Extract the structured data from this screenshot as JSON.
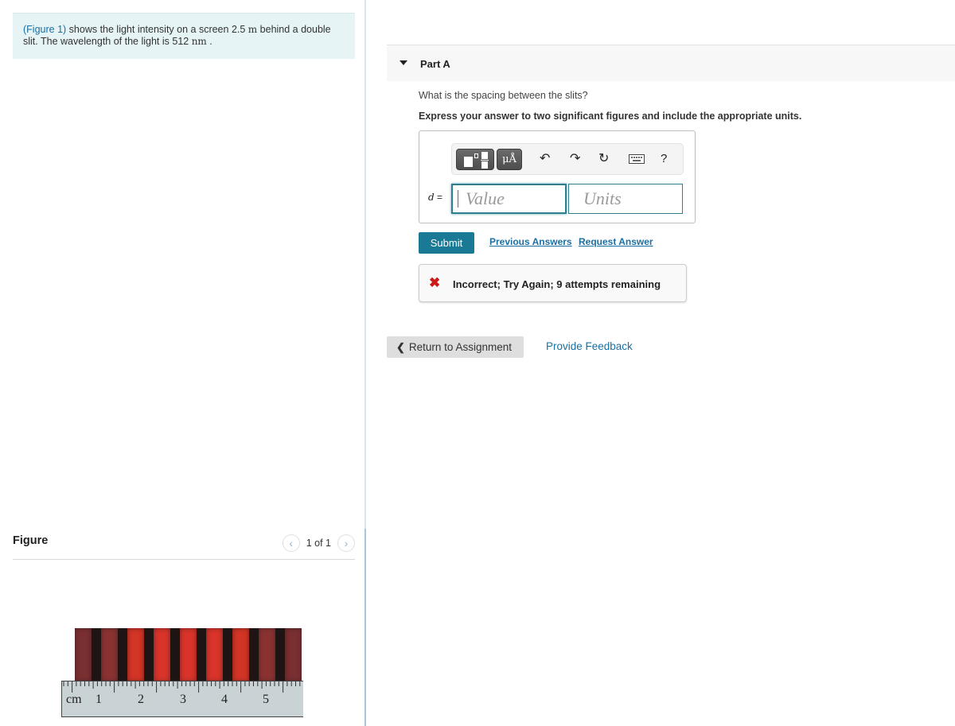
{
  "intro": {
    "figure_link": "(Figure 1)",
    "text_1": " shows the light intensity on a screen 2.5 ",
    "unit_m": "m",
    "text_2": " behind a double slit. The wavelength of the light is 512 ",
    "unit_nm": "nm",
    "text_3": " ."
  },
  "figure_panel": {
    "title": "Figure",
    "pager": {
      "label": "1 of 1",
      "prev_icon": "chevron-left-icon",
      "next_icon": "chevron-right-icon"
    },
    "image": {
      "description": "Double-slit interference fringes above a centimeter ruler",
      "ruler_unit": "cm",
      "ruler_labels": [
        "1",
        "2",
        "3",
        "4",
        "5"
      ],
      "fringe_colors": [
        "#7a2f31",
        "#1e1414",
        "#8a3232",
        "#1e1414",
        "#d23426",
        "#1e1414",
        "#d8342a",
        "#1e1414",
        "#d8342a",
        "#1e1414",
        "#d8342a",
        "#1e1414",
        "#d23426",
        "#1e1414",
        "#8a3232",
        "#1e1414",
        "#7a2f31"
      ]
    }
  },
  "part": {
    "title": "Part A",
    "question": "What is the spacing between the slits?",
    "instruction": "Express your answer to two significant figures and include the appropriate units.",
    "toolbar": {
      "templates_icon": "templates-icon",
      "units_label": "μÅ",
      "undo_icon": "undo-icon",
      "redo_icon": "redo-icon",
      "reset_icon": "reset-icon",
      "keyboard_icon": "keyboard-icon",
      "help_label": "?"
    },
    "variable": "d",
    "equals": " =",
    "value_placeholder": "Value",
    "units_placeholder": "Units",
    "submit_label": "Submit",
    "previous_answers_label": "Previous Answers",
    "request_answer_label": "Request Answer",
    "feedback": {
      "status": "incorrect",
      "text": "Incorrect; Try Again; 9 attempts remaining"
    }
  },
  "footer": {
    "return_label": "Return to Assignment",
    "provide_feedback_label": "Provide Feedback"
  },
  "colors": {
    "accent": "#1a7a96",
    "link": "#1a6fa3",
    "error": "#d01818",
    "intro_bg": "#e6f4f6"
  }
}
